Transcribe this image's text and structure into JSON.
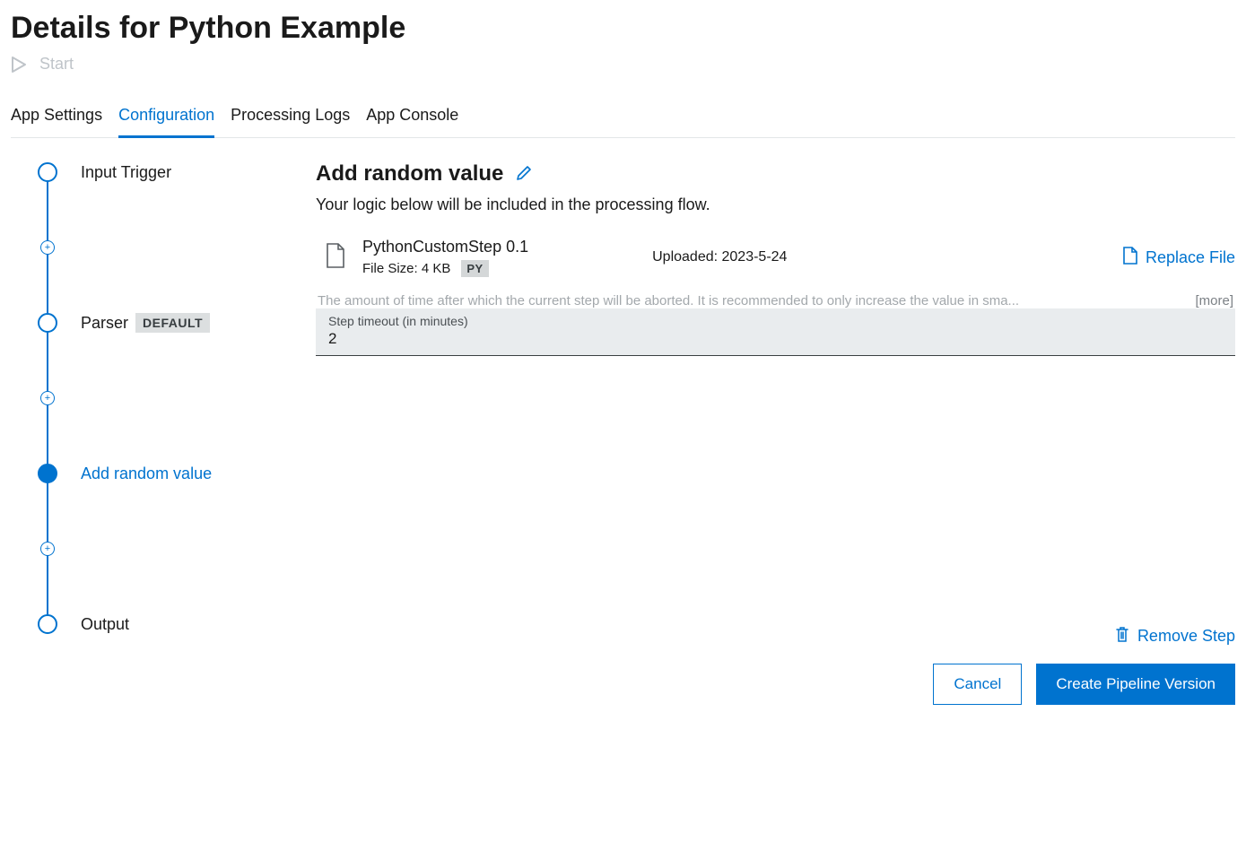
{
  "header": {
    "title": "Details for Python Example",
    "start_label": "Start"
  },
  "tabs": [
    {
      "label": "App Settings",
      "active": false
    },
    {
      "label": "Configuration",
      "active": true
    },
    {
      "label": "Processing Logs",
      "active": false
    },
    {
      "label": "App Console",
      "active": false
    }
  ],
  "pipeline": {
    "nodes": [
      {
        "label": "Input Trigger",
        "type": "node",
        "active": false
      },
      {
        "label": "",
        "type": "add"
      },
      {
        "label": "Parser",
        "type": "node",
        "active": false,
        "badge": "DEFAULT"
      },
      {
        "label": "",
        "type": "add"
      },
      {
        "label": "Add random value",
        "type": "node",
        "active": true
      },
      {
        "label": "",
        "type": "add"
      },
      {
        "label": "Output",
        "type": "node",
        "active": false
      }
    ]
  },
  "step": {
    "title": "Add random value",
    "description": "Your logic below will be included in the processing flow.",
    "file": {
      "name": "PythonCustomStep 0.1",
      "size_label": "File Size: 4 KB",
      "type_badge": "PY",
      "uploaded_label": "Uploaded: 2023-5-24",
      "replace_label": "Replace File"
    },
    "timeout": {
      "help_text": "The amount of time after which the current step will be aborted. It is recommended to only increase the value in sma...",
      "more_label": "[more]",
      "label": "Step timeout (in minutes)",
      "value": "2"
    }
  },
  "footer": {
    "remove_label": "Remove Step",
    "cancel_label": "Cancel",
    "create_label": "Create Pipeline Version"
  }
}
